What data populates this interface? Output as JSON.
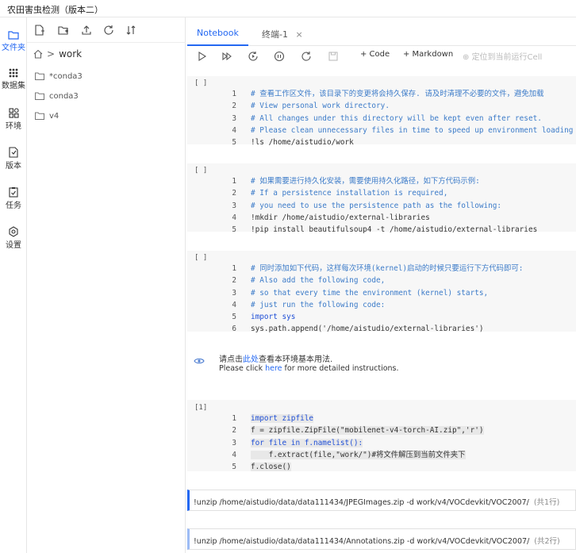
{
  "app": {
    "title": "农田害虫检测（版本二）"
  },
  "nav": [
    {
      "label": "文件夹",
      "icon": "folder-icon"
    },
    {
      "label": "数据集",
      "icon": "dataset-icon"
    },
    {
      "label": "环境",
      "icon": "environment-icon"
    },
    {
      "label": "版本",
      "icon": "version-icon"
    },
    {
      "label": "任务",
      "icon": "task-icon"
    },
    {
      "label": "设置",
      "icon": "settings-icon"
    }
  ],
  "file_panel": {
    "breadcrumb": "work",
    "items": [
      "*conda3",
      "conda3",
      "v4"
    ]
  },
  "tabs": [
    {
      "label": "Notebook"
    },
    {
      "label": "终端-1",
      "close": "×"
    }
  ],
  "toolbar": {
    "code_label": "+ Code",
    "markdown_label": "+ Markdown",
    "locate_label": "定位到当前运行Cell"
  },
  "cells": [
    {
      "prompt": "[ ]",
      "lines": [
        "# 查看工作区文件，该目录下的变更将会持久保存. 请及时清理不必要的文件，避免加载",
        "# View personal work directory.",
        "# All changes under this directory will be kept even after reset.",
        "# Please clean unnecessary files in time to speed up environment loading",
        "!ls /home/aistudio/work"
      ]
    },
    {
      "prompt": "[ ]",
      "lines": [
        "# 如果需要进行持久化安装，需要使用持久化路径，如下方代码示例:",
        "# If a persistence installation is required,",
        "# you need to use the persistence path as the following:",
        "!mkdir /home/aistudio/external-libraries",
        "!pip install beautifulsoup4 -t /home/aistudio/external-libraries"
      ]
    },
    {
      "prompt": "[ ]",
      "lines": [
        "# 同时添加如下代码，这样每次环境(kernel)启动的时候只要运行下方代码即可:",
        "# Also add the following code,",
        "# so that every time the environment (kernel) starts,",
        "# just run the following code:",
        "import sys",
        "sys.path.append('/home/aistudio/external-libraries')"
      ]
    },
    {
      "prompt": "[1]",
      "lines": [
        "import zipfile",
        "f = zipfile.ZipFile(\"mobilenet-v4-torch-AI.zip\",'r')",
        "for file in f.namelist():",
        "    f.extract(file,\"work/\")#将文件解压到当前文件夹下",
        "f.close()"
      ]
    }
  ],
  "markdown": {
    "line1_pre": "请点击",
    "line1_link": "此处",
    "line1_post": "查看本环境基本用法.",
    "line2_pre": "Please click ",
    "line2_link": "here",
    "line2_post": " for more detailed instructions."
  },
  "terminal_cells": [
    {
      "command": "!unzip /home/aistudio/data/data111434/JPEGImages.zip -d work/v4/VOCdevkit/VOC2007/",
      "count": "(共1行)"
    },
    {
      "command": "!unzip /home/aistudio/data/data111434/Annotations.zip -d work/v4/VOCdevkit/VOC2007/",
      "count": "(共2行)"
    }
  ]
}
